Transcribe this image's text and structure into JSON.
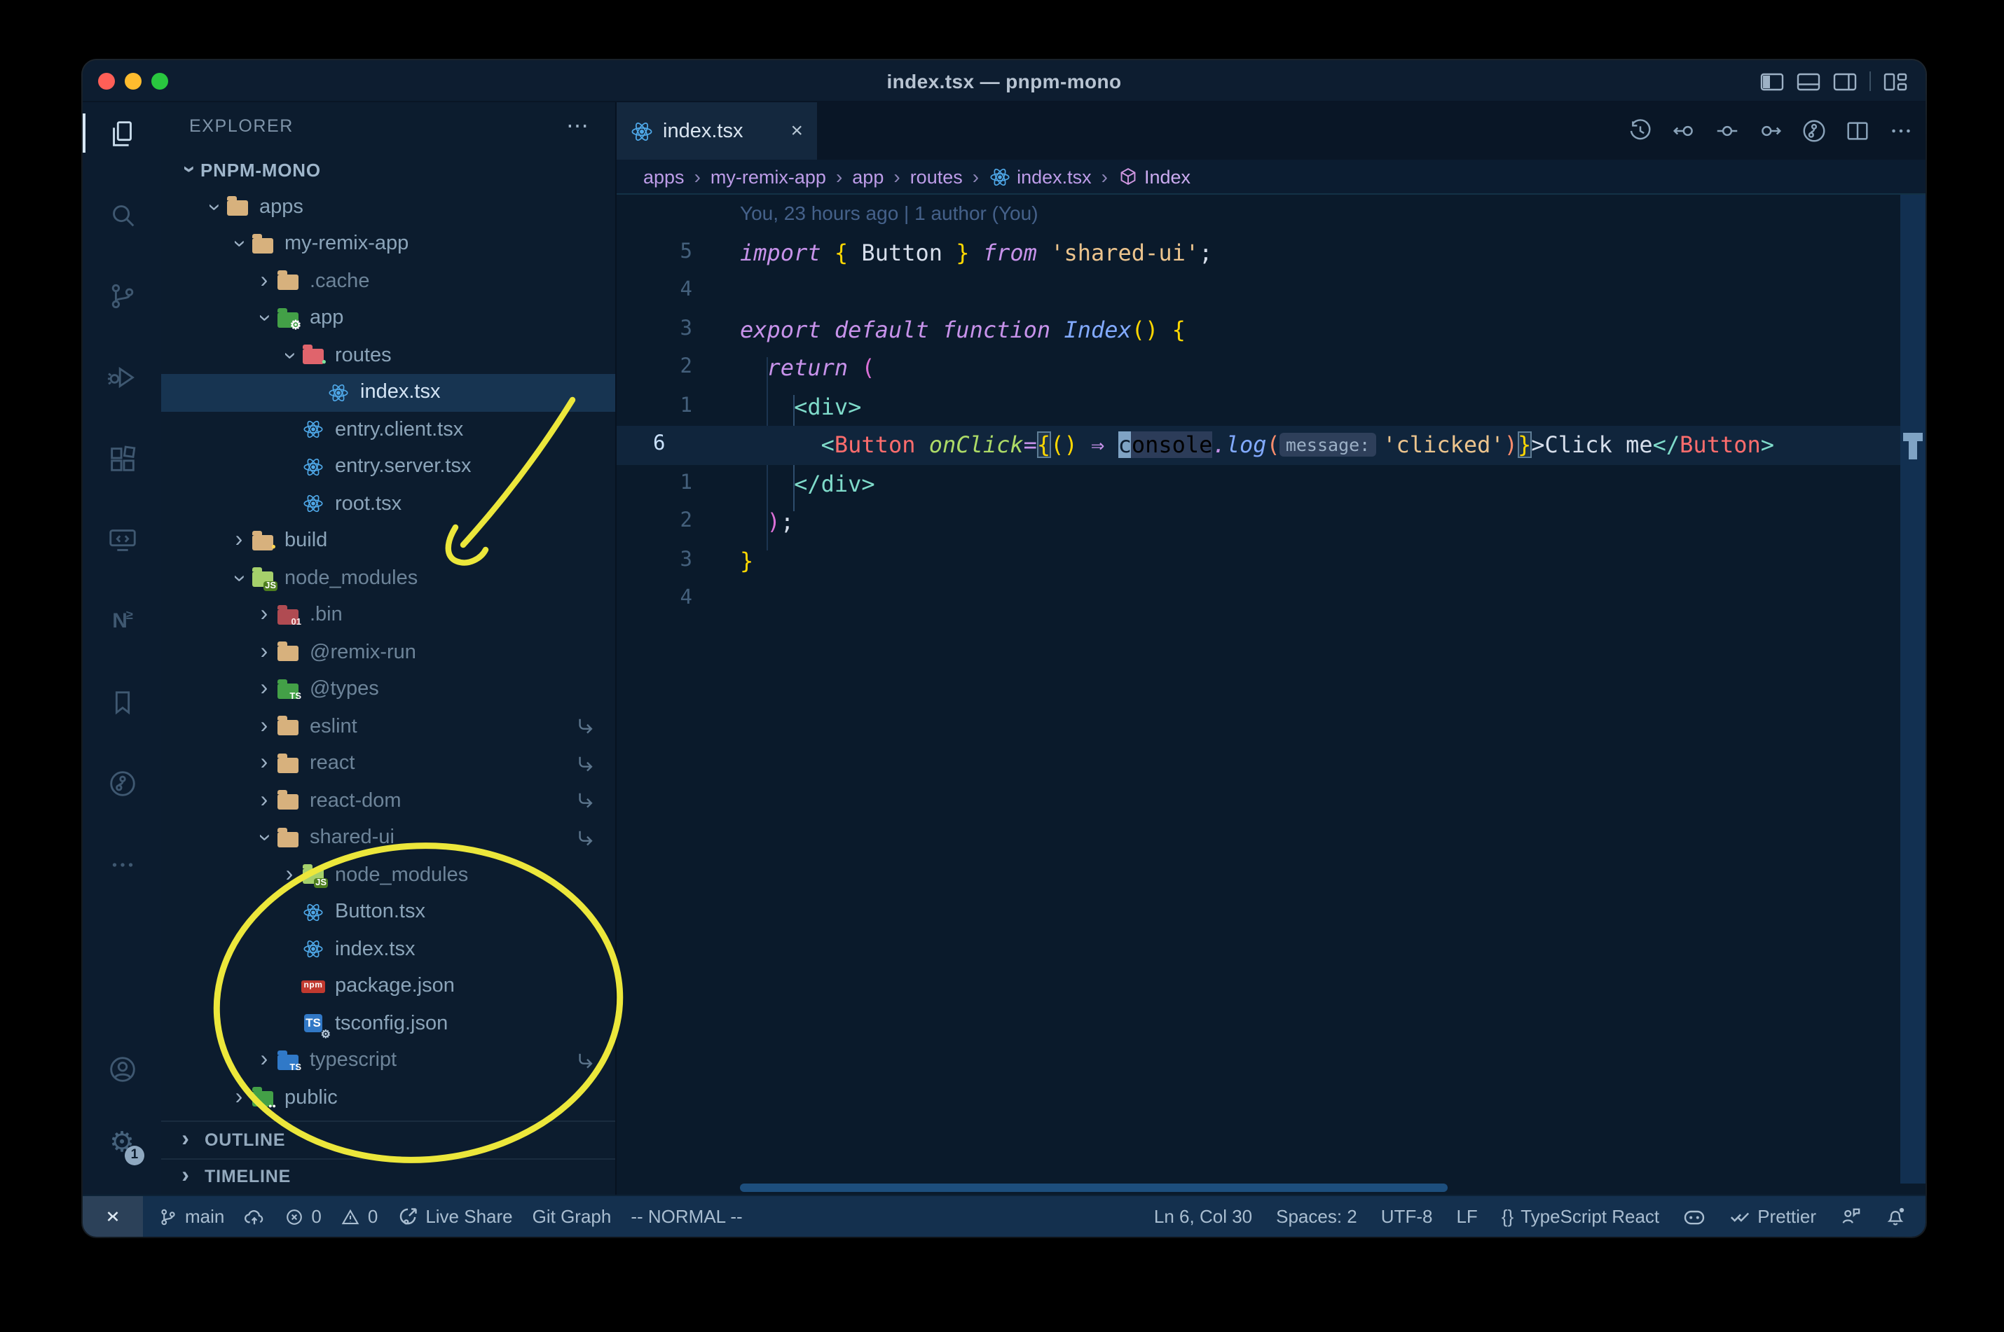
{
  "window": {
    "title": "index.tsx — pnpm-mono"
  },
  "activity": {
    "nx": "N",
    "nx_sub": "≥",
    "settings_badge": "1"
  },
  "sidebar": {
    "header": "EXPLORER",
    "more": "⋯",
    "tree": [
      {
        "label": "PNPM-MONO",
        "level": 0,
        "chevron": "down",
        "icon": null,
        "bold": true
      },
      {
        "label": "apps",
        "level": 1,
        "chevron": "down",
        "icon": "folder-tan"
      },
      {
        "label": "my-remix-app",
        "level": 2,
        "chevron": "down",
        "icon": "folder-tan"
      },
      {
        "label": ".cache",
        "level": 3,
        "chevron": "right",
        "icon": "folder-tan",
        "dim": true
      },
      {
        "label": "app",
        "level": 3,
        "chevron": "down",
        "icon": "folder-app"
      },
      {
        "label": "routes",
        "level": 4,
        "chevron": "down",
        "icon": "folder-routes"
      },
      {
        "label": "index.tsx",
        "level": 5,
        "chevron": null,
        "icon": "react",
        "selected": true
      },
      {
        "label": "entry.client.tsx",
        "level": 4,
        "chevron": null,
        "icon": "react"
      },
      {
        "label": "entry.server.tsx",
        "level": 4,
        "chevron": null,
        "icon": "react"
      },
      {
        "label": "root.tsx",
        "level": 4,
        "chevron": null,
        "icon": "react"
      },
      {
        "label": "build",
        "level": 2,
        "chevron": "right",
        "icon": "folder-build"
      },
      {
        "label": "node_modules",
        "level": 2,
        "chevron": "down",
        "icon": "folder-nm",
        "dim": true
      },
      {
        "label": ".bin",
        "level": 3,
        "chevron": "right",
        "icon": "folder-bin",
        "dim": true
      },
      {
        "label": "@remix-run",
        "level": 3,
        "chevron": "right",
        "icon": "folder-tan",
        "dim": true
      },
      {
        "label": "@types",
        "level": 3,
        "chevron": "right",
        "icon": "folder-types",
        "dim": true
      },
      {
        "label": "eslint",
        "level": 3,
        "chevron": "right",
        "icon": "folder-tan",
        "dim": true,
        "symlink": true
      },
      {
        "label": "react",
        "level": 3,
        "chevron": "right",
        "icon": "folder-tan",
        "dim": true,
        "symlink": true
      },
      {
        "label": "react-dom",
        "level": 3,
        "chevron": "right",
        "icon": "folder-tan",
        "dim": true,
        "symlink": true
      },
      {
        "label": "shared-ui",
        "level": 3,
        "chevron": "down",
        "icon": "folder-tan",
        "dim": true,
        "symlink": true
      },
      {
        "label": "node_modules",
        "level": 4,
        "chevron": "right",
        "icon": "folder-nm",
        "dim": true
      },
      {
        "label": "Button.tsx",
        "level": 4,
        "chevron": null,
        "icon": "react"
      },
      {
        "label": "index.tsx",
        "level": 4,
        "chevron": null,
        "icon": "react"
      },
      {
        "label": "package.json",
        "level": 4,
        "chevron": null,
        "icon": "npm"
      },
      {
        "label": "tsconfig.json",
        "level": 4,
        "chevron": null,
        "icon": "tsjson"
      },
      {
        "label": "typescript",
        "level": 3,
        "chevron": "right",
        "icon": "folder-ts",
        "dim": true,
        "symlink": true
      },
      {
        "label": "public",
        "level": 2,
        "chevron": "right",
        "icon": "folder-public"
      }
    ],
    "sections": [
      {
        "label": "OUTLINE"
      },
      {
        "label": "TIMELINE"
      }
    ]
  },
  "editor": {
    "tab": {
      "label": "index.tsx",
      "close": "×"
    },
    "breadcrumbs": {
      "separator": "›",
      "items": [
        {
          "label": "apps"
        },
        {
          "label": "my-remix-app"
        },
        {
          "label": "app"
        },
        {
          "label": "routes"
        },
        {
          "label": "index.tsx",
          "icon": "react"
        },
        {
          "label": "Index",
          "icon": "symbol",
          "last": true
        }
      ]
    },
    "lines": [
      {
        "type": "blame",
        "text": "You, 23 hours ago | 1 author (You)"
      },
      {
        "num": "5",
        "tokens": [
          {
            "t": "import",
            "c": "kw"
          },
          {
            "t": " ",
            "c": "fg"
          },
          {
            "t": "{",
            "c": "b1"
          },
          {
            "t": " Button ",
            "c": "fg"
          },
          {
            "t": "}",
            "c": "b1"
          },
          {
            "t": " ",
            "c": "fg"
          },
          {
            "t": "from",
            "c": "kw"
          },
          {
            "t": " ",
            "c": "fg"
          },
          {
            "t": "'shared-ui'",
            "c": "str"
          },
          {
            "t": ";",
            "c": "fg"
          }
        ]
      },
      {
        "num": "4",
        "tokens": []
      },
      {
        "num": "3",
        "tokens": [
          {
            "t": "export",
            "c": "kw"
          },
          {
            "t": " ",
            "c": "fg"
          },
          {
            "t": "default",
            "c": "kw"
          },
          {
            "t": " ",
            "c": "fg"
          },
          {
            "t": "function",
            "c": "kw"
          },
          {
            "t": " ",
            "c": "fg"
          },
          {
            "t": "Index",
            "c": "fn"
          },
          {
            "t": "()",
            "c": "b1"
          },
          {
            "t": " ",
            "c": "fg"
          },
          {
            "t": "{",
            "c": "b1"
          }
        ]
      },
      {
        "num": "2",
        "tokens": [
          {
            "t": "  ",
            "c": "fg"
          },
          {
            "t": "return",
            "c": "kw"
          },
          {
            "t": " ",
            "c": "fg"
          },
          {
            "t": "(",
            "c": "b2"
          }
        ]
      },
      {
        "num": "1",
        "tokens": [
          {
            "t": "    ",
            "c": "fg"
          },
          {
            "t": "<div>",
            "c": "teal"
          }
        ]
      },
      {
        "num": "6",
        "current": true,
        "tokens": [
          {
            "t": "      ",
            "c": "fg"
          },
          {
            "t": "<",
            "c": "teal"
          },
          {
            "t": "Button",
            "c": "comp"
          },
          {
            "t": " ",
            "c": "fg"
          },
          {
            "t": "onClick",
            "c": "attr"
          },
          {
            "t": "=",
            "c": "kw"
          },
          {
            "t": "{",
            "c": "match"
          },
          {
            "t": "()",
            "c": "b1"
          },
          {
            "t": " ",
            "c": "fg"
          },
          {
            "t": "⇒",
            "c": "kw"
          },
          {
            "t": " ",
            "c": "fg"
          },
          {
            "t": "c",
            "c": "cursor"
          },
          {
            "t": "onsole",
            "c": "whl"
          },
          {
            "t": ".",
            "c": "kw"
          },
          {
            "t": "log",
            "c": "fn"
          },
          {
            "t": "(",
            "c": "bo"
          },
          {
            "t": "message:",
            "c": "inlay"
          },
          {
            "t": "'clicked'",
            "c": "str"
          },
          {
            "t": ")",
            "c": "bo"
          },
          {
            "t": "}",
            "c": "match"
          },
          {
            "t": ">",
            "c": "fg"
          },
          {
            "t": "Click me",
            "c": "fg"
          },
          {
            "t": "</",
            "c": "teal"
          },
          {
            "t": "Button",
            "c": "comp"
          },
          {
            "t": ">",
            "c": "teal"
          }
        ]
      },
      {
        "num": "1",
        "tokens": [
          {
            "t": "    ",
            "c": "fg"
          },
          {
            "t": "</div>",
            "c": "teal"
          }
        ]
      },
      {
        "num": "2",
        "tokens": [
          {
            "t": "  ",
            "c": "fg"
          },
          {
            "t": ")",
            "c": "b2"
          },
          {
            "t": ";",
            "c": "fg"
          }
        ]
      },
      {
        "num": "3",
        "tokens": [
          {
            "t": "}",
            "c": "b1"
          }
        ]
      },
      {
        "num": "4",
        "tokens": []
      }
    ]
  },
  "status": {
    "left": [
      {
        "name": "remote",
        "icon": "remote"
      },
      {
        "name": "branch",
        "icon": "branch",
        "label": "main"
      },
      {
        "name": "publish",
        "icon": "cloud"
      },
      {
        "name": "problems-errors",
        "icon": "error",
        "label": "0"
      },
      {
        "name": "problems-warnings",
        "icon": "warn",
        "label": "0"
      },
      {
        "name": "live-share",
        "icon": "liveshare",
        "label": "Live Share"
      },
      {
        "name": "git-graph",
        "label": "Git Graph"
      },
      {
        "name": "vim-mode",
        "label": "-- NORMAL --"
      }
    ],
    "right": [
      {
        "name": "cursor-position",
        "label": "Ln 6, Col 30"
      },
      {
        "name": "indentation",
        "label": "Spaces: 2"
      },
      {
        "name": "encoding",
        "label": "UTF-8"
      },
      {
        "name": "eol",
        "label": "LF"
      },
      {
        "name": "language-mode",
        "icon_text": "{}",
        "label": "TypeScript React"
      },
      {
        "name": "copilot",
        "icon": "copilot"
      },
      {
        "name": "prettier",
        "icon": "doublecheck",
        "label": "Prettier"
      },
      {
        "name": "feedback",
        "icon": "feedback"
      },
      {
        "name": "notifications",
        "icon": "bell"
      }
    ]
  },
  "annotations": {
    "color": "#ece73b"
  }
}
